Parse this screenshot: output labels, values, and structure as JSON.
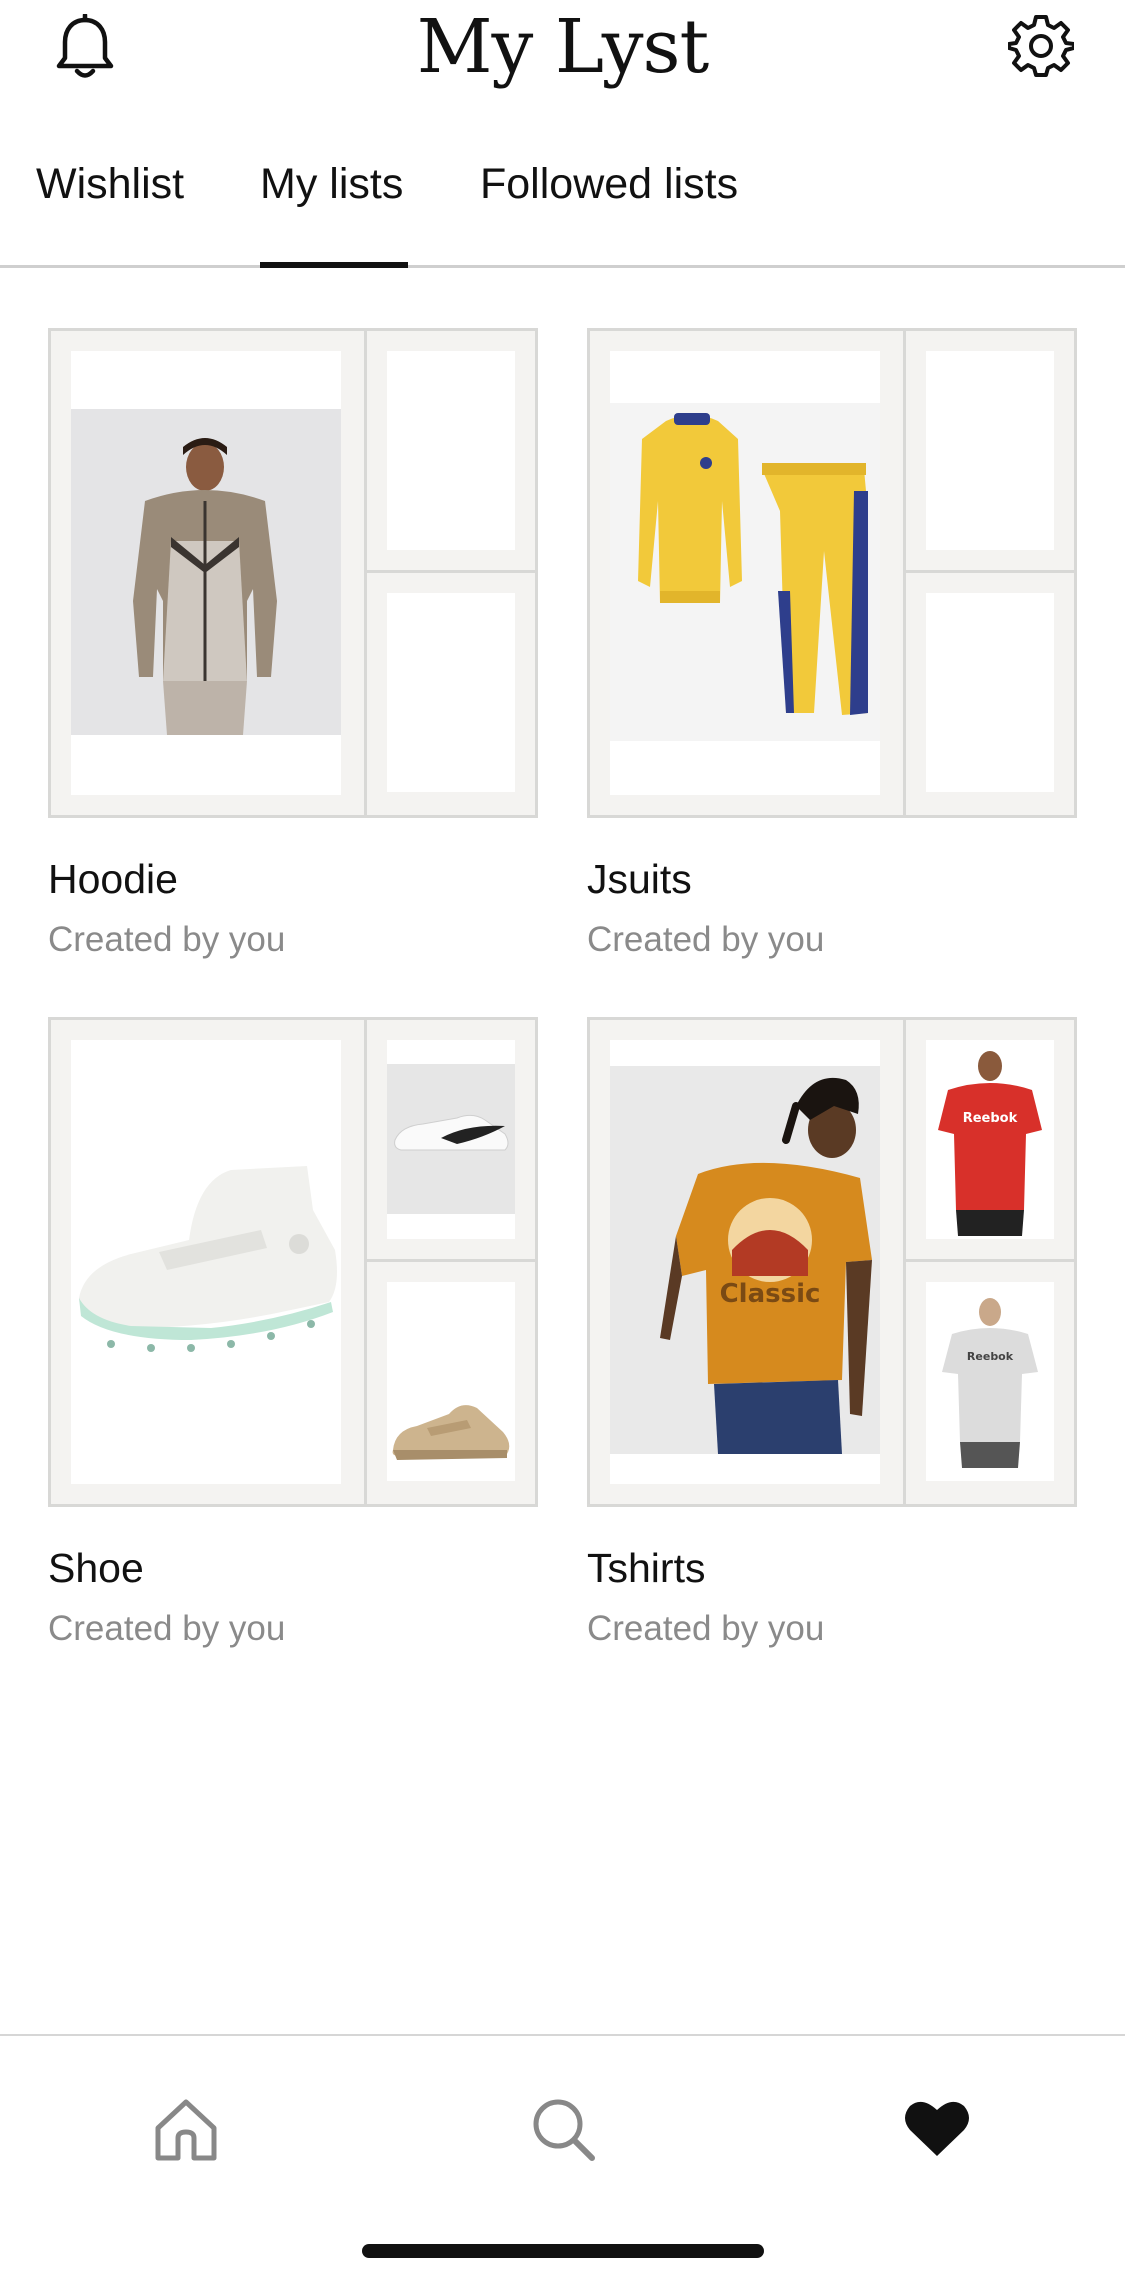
{
  "header": {
    "title": "My Lyst",
    "bell_icon": "bell-icon",
    "settings_icon": "gear-icon"
  },
  "tabs": [
    {
      "label": "Wishlist",
      "active": false
    },
    {
      "label": "My lists",
      "active": true
    },
    {
      "label": "Followed lists",
      "active": false
    }
  ],
  "lists": [
    {
      "name": "Hoodie",
      "subtitle": "Created by you",
      "thumbnails": [
        "hoodie-tracksuit-image",
        "empty",
        "empty"
      ]
    },
    {
      "name": "Jsuits",
      "subtitle": "Created by you",
      "thumbnails": [
        "yellow-tracksuit-image",
        "empty",
        "empty"
      ]
    },
    {
      "name": "Shoe",
      "subtitle": "Created by you",
      "thumbnails": [
        "white-golf-shoe-image",
        "white-sneaker-image",
        "beige-sneaker-image"
      ]
    },
    {
      "name": "Tshirts",
      "subtitle": "Created by you",
      "thumbnails": [
        "mustard-tshirt-image",
        "red-tshirt-image",
        "grey-tshirt-image"
      ]
    }
  ],
  "bottom_nav": [
    {
      "icon": "home-icon",
      "active": false
    },
    {
      "icon": "search-icon",
      "active": false
    },
    {
      "icon": "heart-icon",
      "active": true
    }
  ],
  "colors": {
    "text": "#111111",
    "muted": "#8a8a8a",
    "collage_bg": "#f4f3f1",
    "border": "#d8d8d6"
  }
}
